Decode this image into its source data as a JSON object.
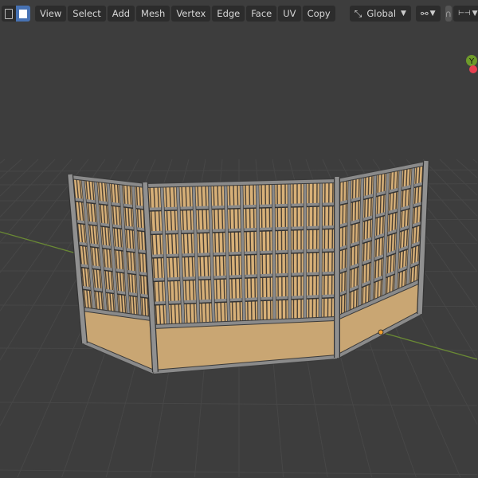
{
  "header": {
    "menus": [
      "View",
      "Select",
      "Add",
      "Mesh",
      "Vertex",
      "Edge",
      "Face",
      "UV",
      "Copy"
    ],
    "transform_orientation": "Global"
  },
  "gizmo": {
    "axis_label": "Y"
  },
  "colors": {
    "background": "#3d3d3d",
    "grid": "#474747",
    "axis_y_line": "#6a8a34",
    "fence_frame": "#8a8a8a",
    "fence_fill": "#d7b078",
    "wainscot": "#c9a673",
    "active_blue": "#4772b3",
    "vertex_selected": "#f0a030"
  }
}
